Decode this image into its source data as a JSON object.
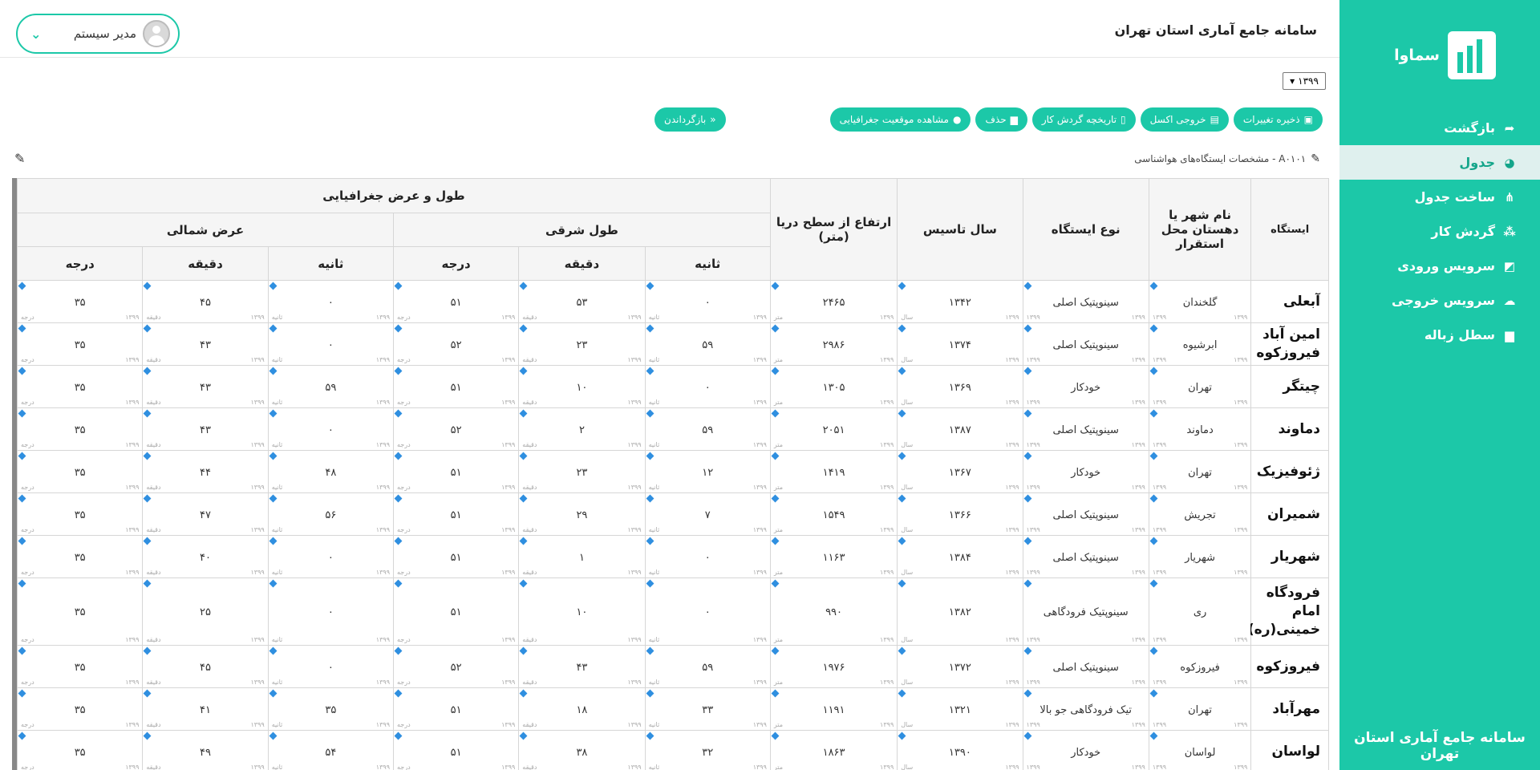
{
  "app": {
    "title": "سامانه جامع آماری استان تهران",
    "footer": "سامانه جامع آماری استان تهران",
    "logo": "سماوا"
  },
  "user": {
    "name": "مدیر سیستم"
  },
  "nav": [
    {
      "label": "بازگشت",
      "icon": "reply-icon"
    },
    {
      "label": "جدول",
      "icon": "pie-chart-icon",
      "active": true
    },
    {
      "label": "ساخت جدول",
      "icon": "sitemap-icon"
    },
    {
      "label": "گردش کار",
      "icon": "users-icon"
    },
    {
      "label": "سرویس ورودی",
      "icon": "area-chart-icon"
    },
    {
      "label": "سرویس خروجی",
      "icon": "cloud-icon"
    },
    {
      "label": "سطل زباله",
      "icon": "trash-icon"
    }
  ],
  "year": "۱۳۹۹",
  "toolbar": {
    "save": "ذخیره تغییرات",
    "excel": "خروجی اکسل",
    "history": "تاریخچه گردش کار",
    "delete": "حذف",
    "geo": "مشاهده موقعیت جغرافیایی",
    "back": "بازگرداندن"
  },
  "breadcrumb": "A۰۱۰۱ - مشخصات ایستگاه‌های هواشناسی",
  "headers": {
    "station": "ایستگاه",
    "city": "نام شهر یا دهستان محل استقرار",
    "type": "نوع ایستگاه",
    "year": "سال تاسیس",
    "elevation": "ارتفاع از سطح دریا (متر)",
    "geo": "طول و عرض جغرافیایی",
    "east": "طول شرقی",
    "north": "عرض شمالی",
    "second": "ثانیه",
    "minute": "دقیقه",
    "degree": "درجه"
  },
  "sublabels": {
    "year": "۱۳۹۹",
    "sal": "سال",
    "metr": "متر",
    "sanie": "ثانیه",
    "daqiqe": "دقیقه",
    "daraje": "درجه"
  },
  "rows": [
    {
      "station": "آبعلی",
      "city": "گلخندان",
      "type": "سینوپتیک اصلی",
      "year": "۱۳۴۲",
      "elev": "۲۴۶۵",
      "e_sec": "۰",
      "e_min": "۵۳",
      "e_deg": "۵۱",
      "n_sec": "۰",
      "n_min": "۴۵",
      "n_deg": "۳۵"
    },
    {
      "station": "امین آباد فیروزکوه",
      "city": "ابرشیوه",
      "type": "سینوپتیک اصلی",
      "year": "۱۳۷۴",
      "elev": "۲۹۸۶",
      "e_sec": "۵۹",
      "e_min": "۲۳",
      "e_deg": "۵۲",
      "n_sec": "۰",
      "n_min": "۴۳",
      "n_deg": "۳۵"
    },
    {
      "station": "چیتگر",
      "city": "تهران",
      "type": "خودکار",
      "year": "۱۳۶۹",
      "elev": "۱۳۰۵",
      "e_sec": "۰",
      "e_min": "۱۰",
      "e_deg": "۵۱",
      "n_sec": "۵۹",
      "n_min": "۴۳",
      "n_deg": "۳۵"
    },
    {
      "station": "دماوند",
      "city": "دماوند",
      "type": "سینوپتیک اصلی",
      "year": "۱۳۸۷",
      "elev": "۲۰۵۱",
      "e_sec": "۵۹",
      "e_min": "۲",
      "e_deg": "۵۲",
      "n_sec": "۰",
      "n_min": "۴۳",
      "n_deg": "۳۵"
    },
    {
      "station": "ژئوفیزیک",
      "city": "تهران",
      "type": "خودکار",
      "year": "۱۳۶۷",
      "elev": "۱۴۱۹",
      "e_sec": "۱۲",
      "e_min": "۲۳",
      "e_deg": "۵۱",
      "n_sec": "۴۸",
      "n_min": "۴۴",
      "n_deg": "۳۵"
    },
    {
      "station": "شمیران",
      "city": "تجریش",
      "type": "سینوپتیک اصلی",
      "year": "۱۳۶۶",
      "elev": "۱۵۴۹",
      "e_sec": "۷",
      "e_min": "۲۹",
      "e_deg": "۵۱",
      "n_sec": "۵۶",
      "n_min": "۴۷",
      "n_deg": "۳۵"
    },
    {
      "station": "شهریار",
      "city": "شهریار",
      "type": "سینوپتیک اصلی",
      "year": "۱۳۸۴",
      "elev": "۱۱۶۳",
      "e_sec": "۰",
      "e_min": "۱",
      "e_deg": "۵۱",
      "n_sec": "۰",
      "n_min": "۴۰",
      "n_deg": "۳۵"
    },
    {
      "station": "فرودگاه امام خمینی(ره)",
      "city": "ری",
      "type": "سینوپتیک فرودگاهی",
      "year": "۱۳۸۲",
      "elev": "۹۹۰",
      "e_sec": "۰",
      "e_min": "۱۰",
      "e_deg": "۵۱",
      "n_sec": "۰",
      "n_min": "۲۵",
      "n_deg": "۳۵"
    },
    {
      "station": "فیروزکوه",
      "city": "فیروزکوه",
      "type": "سینوپتیک اصلی",
      "year": "۱۳۷۲",
      "elev": "۱۹۷۶",
      "e_sec": "۵۹",
      "e_min": "۴۳",
      "e_deg": "۵۲",
      "n_sec": "۰",
      "n_min": "۴۵",
      "n_deg": "۳۵"
    },
    {
      "station": "مهرآباد",
      "city": "تهران",
      "type": "تیک فرودگاهی جو بالا",
      "year": "۱۳۲۱",
      "elev": "۱۱۹۱",
      "e_sec": "۳۳",
      "e_min": "۱۸",
      "e_deg": "۵۱",
      "n_sec": "۳۵",
      "n_min": "۴۱",
      "n_deg": "۳۵"
    },
    {
      "station": "لواسان",
      "city": "لواسان",
      "type": "خودکار",
      "year": "۱۳۹۰",
      "elev": "۱۸۶۳",
      "e_sec": "۳۲",
      "e_min": "۳۸",
      "e_deg": "۵۱",
      "n_sec": "۵۴",
      "n_min": "۴۹",
      "n_deg": "۳۵"
    }
  ]
}
